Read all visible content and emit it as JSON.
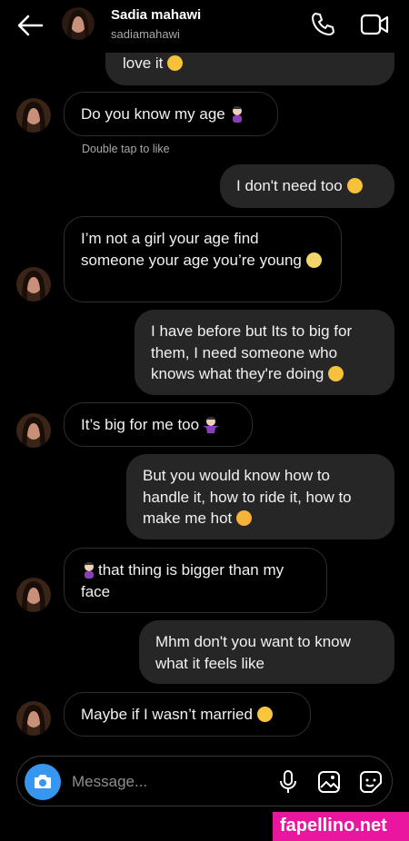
{
  "header": {
    "name": "Sadia mahawi",
    "username": "sadiamahawi",
    "back_icon": "back-arrow-icon",
    "call_icon": "phone-icon",
    "video_icon": "video-camera-icon"
  },
  "messages": [
    {
      "dir": "out",
      "text": "love it",
      "emoji": "smirk"
    },
    {
      "dir": "in",
      "text": "Do you know my age",
      "emoji": "woman-facepalm"
    },
    {
      "dir": "meta",
      "text": "Double tap to like"
    },
    {
      "dir": "out",
      "text": "I don't need too",
      "emoji": "smirk"
    },
    {
      "dir": "in",
      "text": "I’m not a girl your age find someone your age you’re young",
      "emoji": "eye-roll"
    },
    {
      "dir": "out",
      "text": "I have before but Its to big for them, I need someone who knows what they're doing",
      "emoji": "smirk"
    },
    {
      "dir": "in",
      "text": "It’s big for me too",
      "emoji": "woman-shrug"
    },
    {
      "dir": "out",
      "text": "But you would know how to handle it, how to ride it, how to make me hot",
      "emoji": "hot-face"
    },
    {
      "dir": "in",
      "text": "that thing is bigger than my face",
      "emoji": "woman-facepalm"
    },
    {
      "dir": "out",
      "text": "Mhm don't you want to know what it feels like"
    },
    {
      "dir": "in",
      "text": "Maybe if I wasn’t married",
      "emoji": "blush"
    }
  ],
  "composer": {
    "placeholder": "Message...",
    "camera_icon": "camera-icon",
    "mic_icon": "microphone-icon",
    "gallery_icon": "gallery-icon",
    "sticker_icon": "sticker-icon"
  },
  "watermark": "fapellino.net",
  "colors": {
    "background": "#000000",
    "outgoing_bubble": "#262626",
    "incoming_border": "#2e2e2e",
    "camera_button": "#3797f0",
    "watermark": "#e9179f"
  }
}
